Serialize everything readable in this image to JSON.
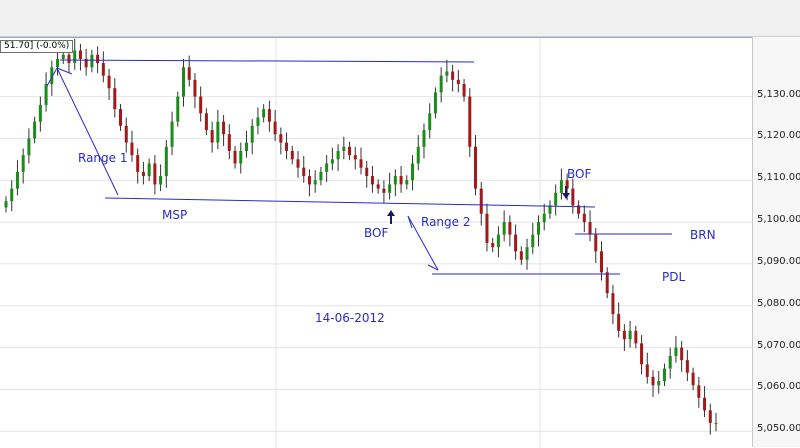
{
  "header": {
    "readout": "51.70] (-0.0%)"
  },
  "chart_data": {
    "type": "candlestick",
    "date_label": "14-06-2012",
    "y_axis": {
      "min": 5046,
      "max": 5144,
      "ticks": [
        5050,
        5060,
        5070,
        5080,
        5090,
        5100,
        5110,
        5120,
        5130
      ],
      "tick_labels": [
        "5,050.00",
        "5,060.00",
        "5,070.00",
        "5,080.00",
        "5,090.00",
        "5,100.00",
        "5,110.00",
        "5,120.00",
        "5,130.00"
      ]
    },
    "colors": {
      "up": "#1a8c1a",
      "down": "#a31818",
      "annotation": "#2a2acc",
      "grid": "#e4e4e4"
    },
    "closes": [
      5105,
      5108,
      5112,
      5116,
      5120,
      5124,
      5128,
      5133,
      5137,
      5139,
      5140,
      5138,
      5141,
      5139,
      5137,
      5140,
      5138,
      5135,
      5132,
      5127,
      5123,
      5119,
      5116,
      5112,
      5111,
      5114,
      5109,
      5111,
      5118,
      5124,
      5130,
      5137,
      5134,
      5130,
      5126,
      5122,
      5119,
      5124,
      5121,
      5117,
      5114,
      5117,
      5119,
      5123,
      5125,
      5127,
      5124,
      5121,
      5119,
      5117,
      5115,
      5113,
      5111,
      5109,
      5110,
      5112,
      5114,
      5115,
      5117,
      5118,
      5116,
      5115,
      5113,
      5111,
      5109,
      5108,
      5107,
      5109,
      5111,
      5109,
      5110,
      5114,
      5118,
      5122,
      5126,
      5131,
      5135,
      5136,
      5134,
      5133,
      5130,
      5118,
      5108,
      5102,
      5095,
      5094,
      5097,
      5100,
      5097,
      5093,
      5091,
      5094,
      5097,
      5100,
      5102,
      5104,
      5107,
      5110,
      5108,
      5104,
      5102,
      5100,
      5097,
      5093,
      5088,
      5083,
      5078,
      5074,
      5072,
      5074,
      5071,
      5066,
      5063,
      5061,
      5062,
      5065,
      5068,
      5070,
      5067,
      5064,
      5061,
      5058,
      5055,
      5052,
      5052
    ],
    "annotations": {
      "range1": "Range 1",
      "range2": "Range 2",
      "msp": "MSP",
      "bof1": "BOF",
      "bof2": "BOF",
      "brn": "BRN",
      "pdl": "PDL"
    }
  }
}
